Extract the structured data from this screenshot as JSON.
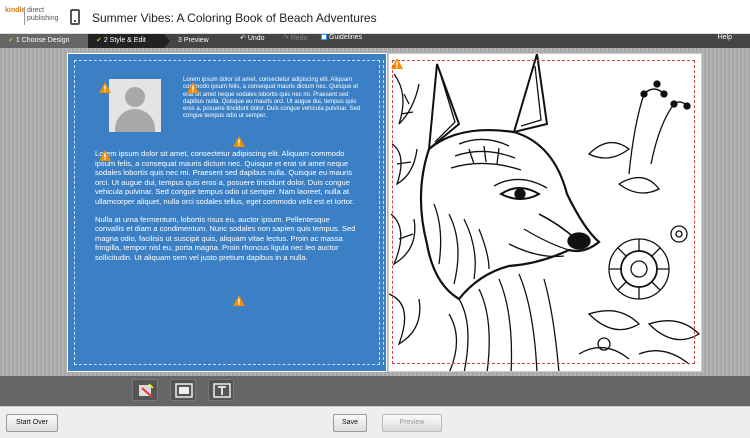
{
  "header": {
    "logo_line1": "kindle",
    "logo_line2": "direct",
    "logo_line3": "publishing",
    "title": "Summer Vibes: A Coloring Book of Beach Adventures"
  },
  "steps": {
    "step1": "1 Choose Design",
    "step2": "2 Style & Edit",
    "step3": "3 Preview",
    "undo": "Undo",
    "redo": "Redo",
    "guidelines": "Guidelines",
    "help": "Help"
  },
  "back_cover": {
    "bio": "Lorem ipsum dolor sit amet, consectetur adipiscing elit. Aliquam commodo ipsum felis, a consequat mauris dictum nec. Quisque et erat sit amet neque sodales lobortis quis nec mi. Praesent sed dapibus nulla. Quisque eu mauris orci. Ut augue dui, tempus quis eros a, posuere tincidunt dolor. Duis congue vehicula pulvinar. Sed congue tempus odio ut semper.",
    "paragraph1": "Lorem ipsum dolor sit amet, consectetur adipiscing elit. Aliquam commodo ipsum felis, a consequat mauris dictum nec. Quisque et erat sit amet neque sodales lobortis quis nec mi. Praesent sed dapibus nulla. Quisque eu mauris orci. Ut augue dui, tempus quis eros a, posuere tincidunt dolor. Duis congue vehicula pulvinar. Sed congue tempus odio ut semper. Nam laoreet, nulla at ullamcorper aliquet, nulla orci sodales tellus, eget commodo velit est et tortor.",
    "paragraph2": "Nulla at urna fermentum, lobortis risus eu, auctor ipsum. Pellentesque convallis et diam a condimentum. Nunc sodales non sapien quis tempus. Sed magna odio, facilisis ut suscipit quis, aliquam vitae lectus. Proin ac massa fringilla, tempor nisl eu, porta magna. Proin rhoncus ligula nec leo auctor sollicitudin. Ut aliquam sem vel justo pretium dapibus in a nulla."
  },
  "footer": {
    "start_over": "Start Over",
    "save": "Save",
    "preview": "Preview"
  },
  "colors": {
    "back_cover_bg": "#3b7fc4",
    "warning": "#f28c00",
    "accent_check": "#99cc33"
  }
}
